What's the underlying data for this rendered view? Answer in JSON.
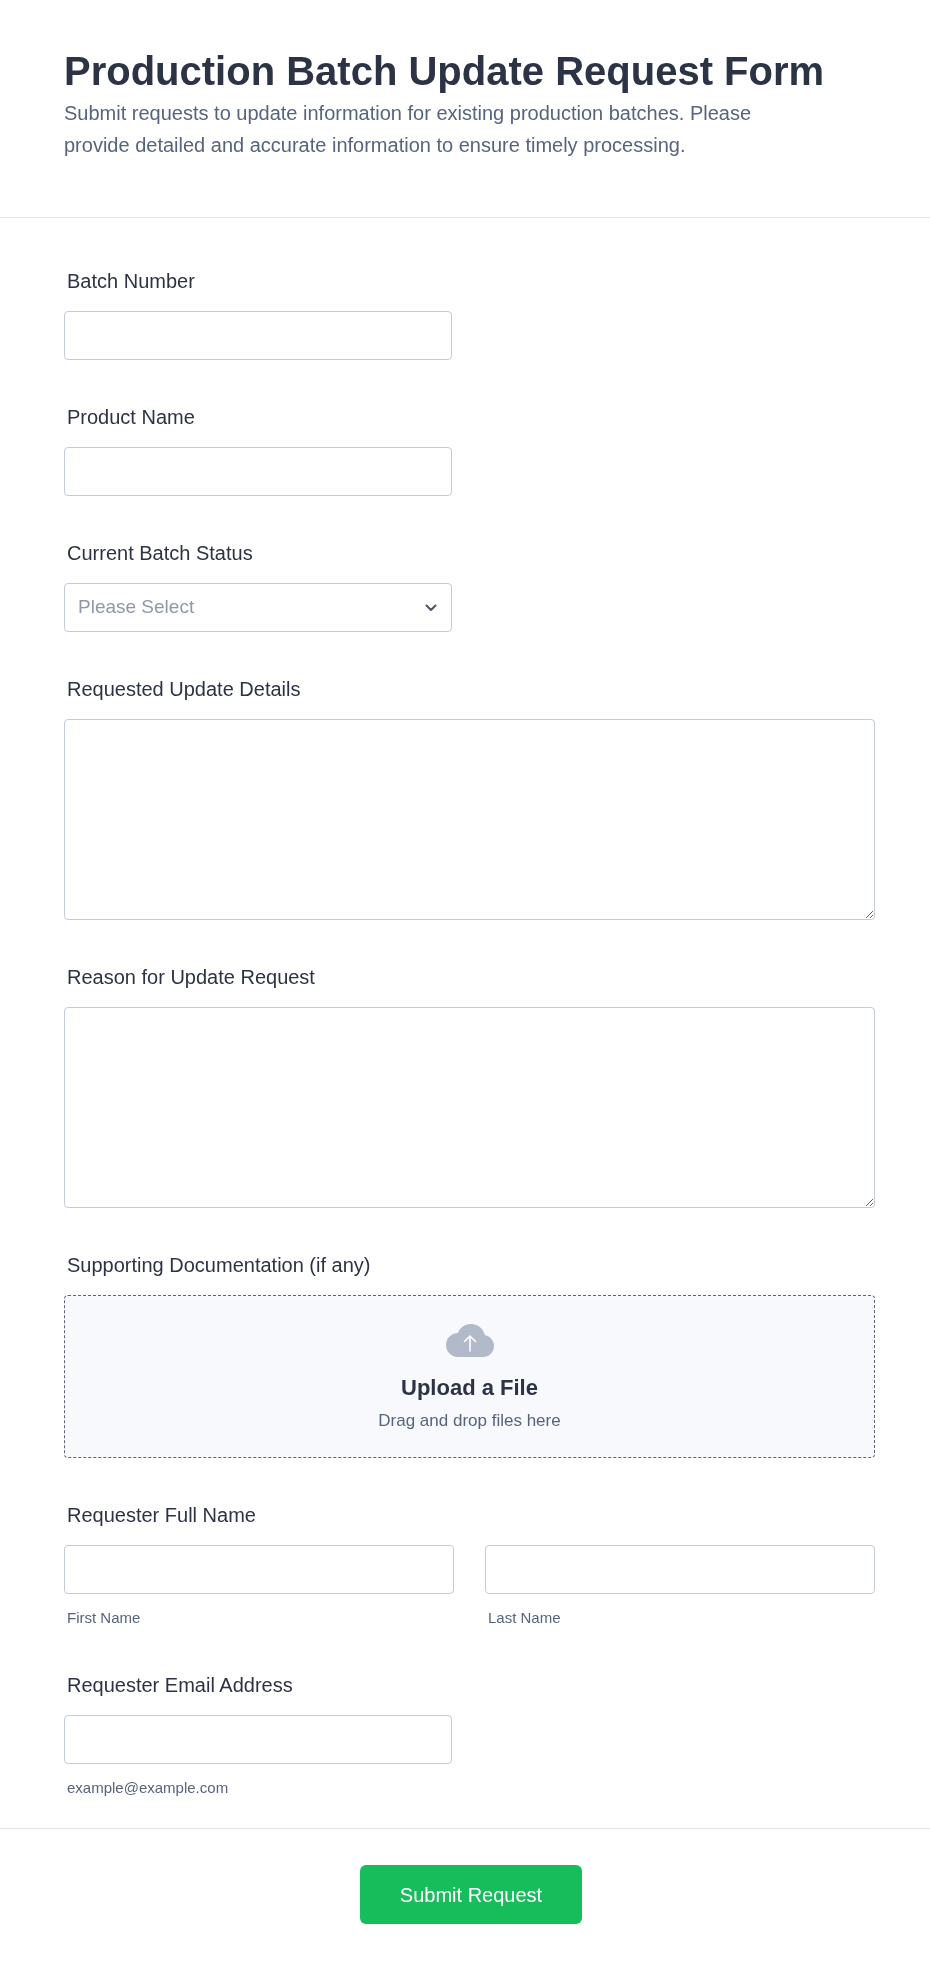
{
  "header": {
    "title": "Production Batch Update Request Form",
    "description": "Submit requests to update information for existing production batches. Please provide detailed and accurate information to ensure timely processing."
  },
  "fields": [
    {
      "kind": "text",
      "label": "Batch Number"
    },
    {
      "kind": "text",
      "label": "Product Name"
    },
    {
      "kind": "select",
      "label": "Current Batch Status",
      "placeholder": "Please Select"
    },
    {
      "kind": "textarea",
      "label": "Requested Update Details"
    },
    {
      "kind": "textarea",
      "label": "Reason for Update Request"
    },
    {
      "kind": "upload",
      "label": "Supporting Documentation (if any)",
      "title": "Upload a File",
      "hint": "Drag and drop files here"
    },
    {
      "kind": "name",
      "label": "Requester Full Name",
      "parts": [
        {
          "sublabel": "First Name"
        },
        {
          "sublabel": "Last Name"
        }
      ]
    },
    {
      "kind": "email",
      "label": "Requester Email Address",
      "sublabel": "example@example.com"
    }
  ],
  "submit": {
    "label": "Submit Request"
  }
}
